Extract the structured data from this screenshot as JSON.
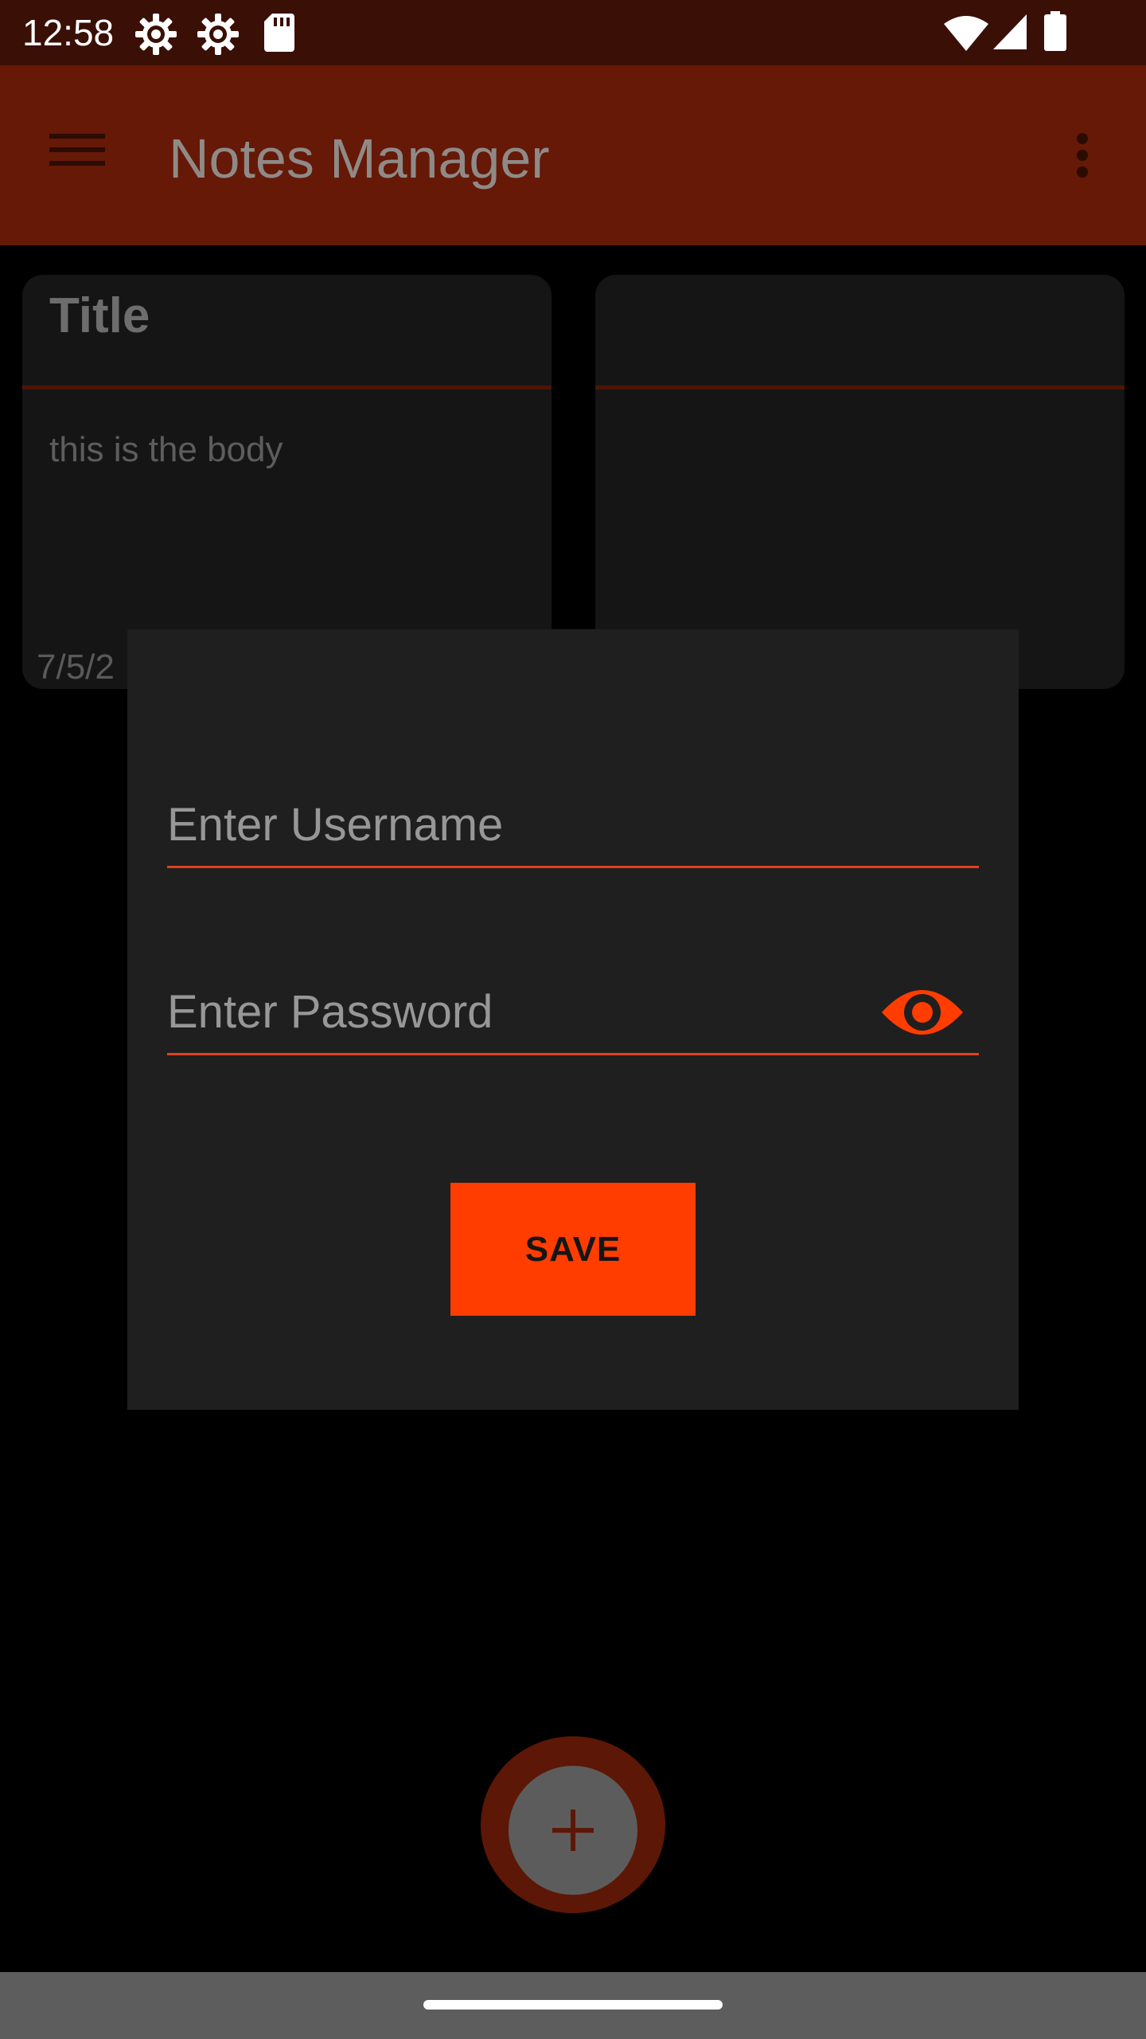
{
  "status_bar": {
    "time": "12:58",
    "icons": [
      "settings-gear-icon",
      "settings-gear-icon",
      "sd-card-icon",
      "wifi-icon",
      "cell-signal-icon",
      "battery-icon"
    ]
  },
  "app_bar": {
    "title": "Notes Manager",
    "icons": [
      "menu-icon",
      "overflow-menu-icon"
    ],
    "background_color": "#651906"
  },
  "notes": [
    {
      "title": "Title",
      "body": "this is the body",
      "date": "7/5/2"
    },
    {
      "title": "",
      "body": "",
      "date": ""
    }
  ],
  "dialog": {
    "username_placeholder": "Enter Username",
    "password_placeholder": "Enter Password",
    "password_toggle_icon": "eye-icon",
    "save_label": "SAVE",
    "accent_color": "#ff3d00"
  },
  "fab": {
    "icon": "plus-icon"
  }
}
